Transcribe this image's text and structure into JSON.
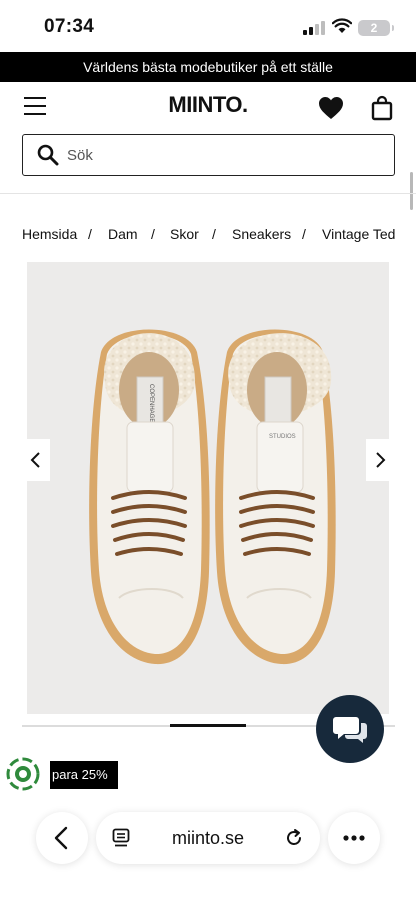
{
  "status_bar": {
    "time": "07:34",
    "battery_level": "2",
    "icons": [
      "signal-icon",
      "wifi-icon",
      "battery-icon"
    ]
  },
  "promo_banner": {
    "text": "Världens bästa modebutiker på ett ställe"
  },
  "header": {
    "logo": "MIINTO.",
    "icons": [
      "menu-icon",
      "heart-icon",
      "shopping-bag-icon"
    ]
  },
  "search": {
    "placeholder": "Sök",
    "value": ""
  },
  "breadcrumb": {
    "items": [
      "Hemsida",
      "Dam",
      "Skor",
      "Sneakers",
      "Vintage Ted"
    ],
    "separator": "/"
  },
  "product_image": {
    "brand_on_tongue": "COPENHAGEN STUDIOS",
    "brand_on_heel": "STUDIOS",
    "colors": {
      "background": "#ecebea",
      "upper": "#f3f0ea",
      "shearling": "#efe6d6",
      "sole": "#d9a86a",
      "laces": "#7a4e2a"
    }
  },
  "gallery": {
    "icons": [
      "chevron-left-icon",
      "chevron-right-icon"
    ]
  },
  "chat": {
    "icon": "chat-icon",
    "color": "#17293b"
  },
  "savings_badge": {
    "label": "para 25%",
    "icon": "circular-badge-icon"
  },
  "browser": {
    "url": "miinto.se",
    "icons": [
      "back-icon",
      "tabs-icon",
      "reload-icon",
      "more-icon"
    ]
  }
}
